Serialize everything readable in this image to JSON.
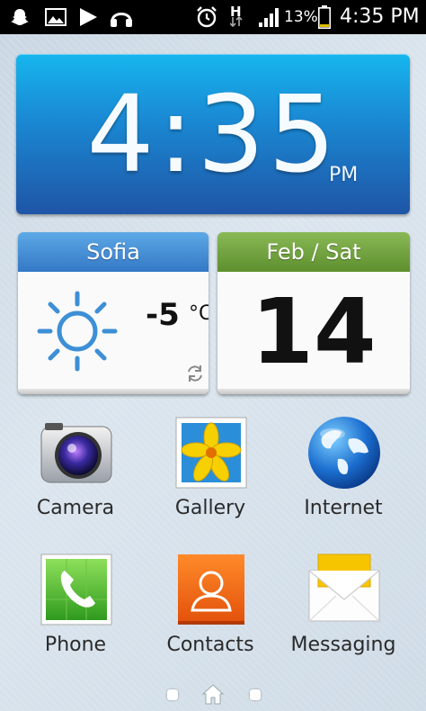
{
  "status_bar": {
    "battery_percent": "13%",
    "time": "4:35 PM",
    "network_type": "H"
  },
  "clock_widget": {
    "time": "4:35",
    "ampm": "PM"
  },
  "weather_widget": {
    "city": "Sofia",
    "temperature": "-5",
    "unit": "°C"
  },
  "date_widget": {
    "header": "Feb / Sat",
    "day": "14"
  },
  "apps": [
    {
      "label": "Camera"
    },
    {
      "label": "Gallery"
    },
    {
      "label": "Internet"
    },
    {
      "label": "Phone"
    },
    {
      "label": "Contacts"
    },
    {
      "label": "Messaging"
    }
  ],
  "colors": {
    "clock_top": "#16b6ee",
    "clock_bottom": "#1f55a6",
    "weather_header": "#3478c6",
    "date_header": "#5e8f2e",
    "battery_low": "#e0c000"
  }
}
